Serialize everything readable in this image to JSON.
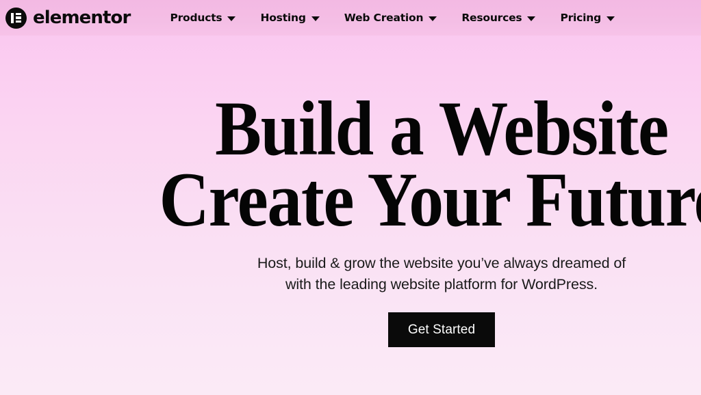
{
  "header": {
    "brand": {
      "name": "elementor",
      "logo_icon": "elementor-logo-icon"
    },
    "nav_items": [
      {
        "label": "Products",
        "icon": "chevron-down-icon",
        "has_dropdown": true
      },
      {
        "label": "Hosting",
        "icon": "chevron-down-icon",
        "has_dropdown": true
      },
      {
        "label": "Web Creation",
        "icon": "chevron-down-icon",
        "has_dropdown": true
      },
      {
        "label": "Resources",
        "icon": "chevron-down-icon",
        "has_dropdown": true
      },
      {
        "label": "Pricing",
        "icon": "chevron-down-icon",
        "has_dropdown": true
      }
    ],
    "background_color": "#f3b9e3"
  },
  "hero": {
    "title_line_1": "Build a Website",
    "title_line_2": "Create Your Future",
    "subtitle_line_1": "Host, build & grow the website you’ve always dreamed of",
    "subtitle_line_2": "with the leading website platform for WordPress.",
    "cta_label": "Get Started",
    "cta_background_color": "#0a0a0a",
    "cta_text_color": "#ffffff",
    "gradient_top_color": "#f9c4ef",
    "gradient_bottom_color": "#fbeaf6",
    "text_color": "#050505"
  }
}
